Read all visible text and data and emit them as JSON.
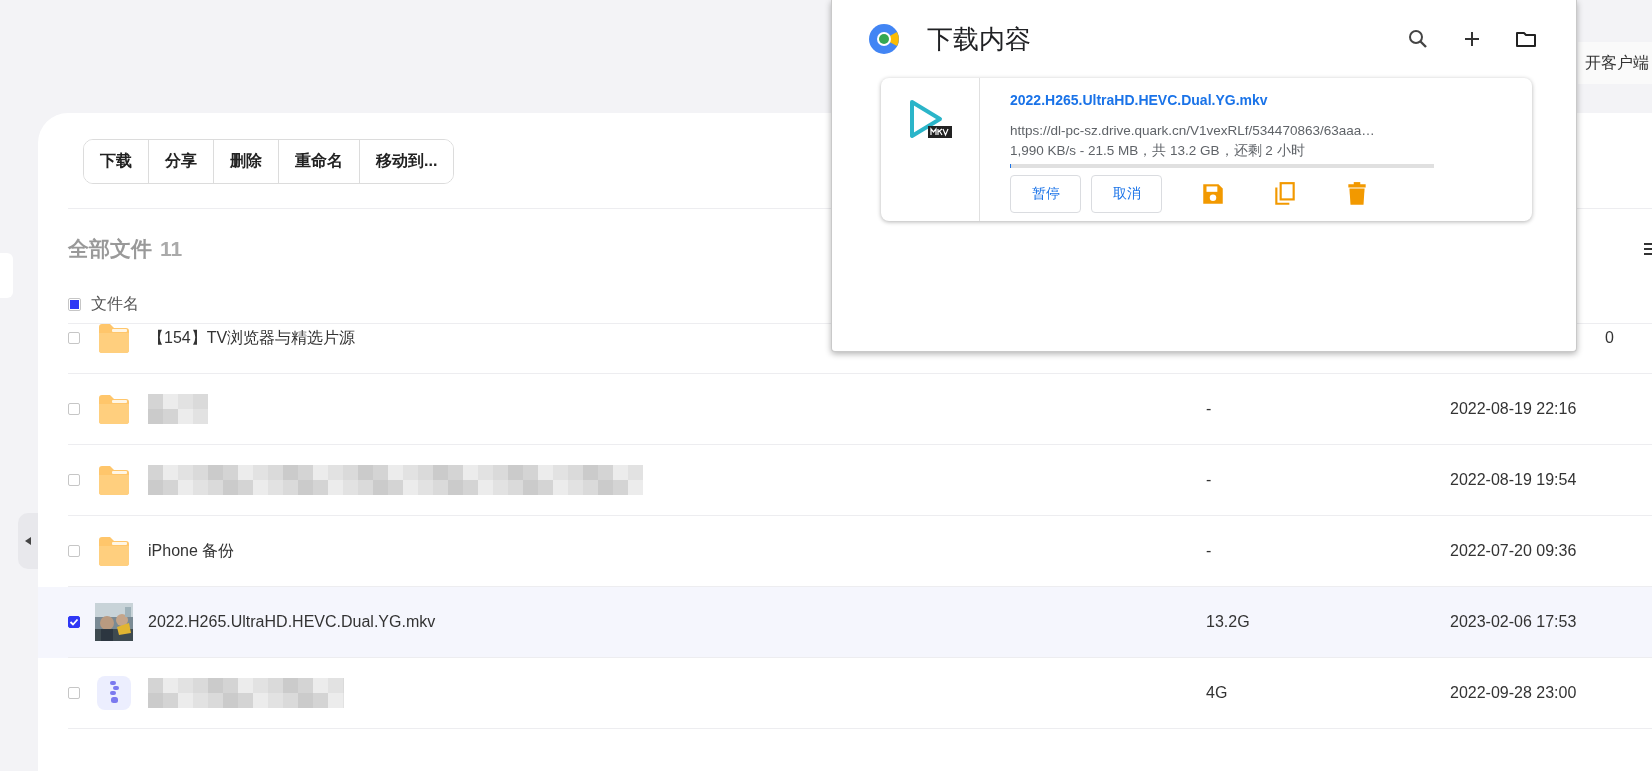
{
  "top_bar": {
    "client_button": "开客户端"
  },
  "toolbar": {
    "buttons": [
      "下载",
      "分享",
      "删除",
      "重命名",
      "移动到..."
    ]
  },
  "folder_title": {
    "label": "全部文件",
    "count": "11"
  },
  "table": {
    "select_all": {
      "indeterminate": true
    },
    "columns": [
      "文件名"
    ],
    "rows": [
      {
        "kind": "folder",
        "name": "【154】TV浏览器与精选片源",
        "checked": false,
        "date": "0",
        "covered_by_popup": true
      },
      {
        "kind": "folder",
        "redacted": true,
        "checked": false,
        "size": "-",
        "date": "2022-08-19 22:16"
      },
      {
        "kind": "folder",
        "redacted": true,
        "checked": false,
        "size": "-",
        "date": "2022-08-19 19:54"
      },
      {
        "kind": "folder",
        "name": "iPhone 备份",
        "checked": false,
        "size": "-",
        "date": "2022-07-20 09:36"
      },
      {
        "kind": "video",
        "name": "2022.H265.UltraHD.HEVC.Dual.YG.mkv",
        "checked": true,
        "size": "13.2G",
        "date": "2023-02-06 17:53"
      },
      {
        "kind": "archive",
        "redacted": true,
        "checked": false,
        "size": "4G",
        "date": "2022-09-28 23:00"
      }
    ]
  },
  "download_popup": {
    "title": "下载内容",
    "item": {
      "file_name": "2022.H265.UltraHD.HEVC.Dual.YG.mkv",
      "url": "https://dl-pc-sz.drive.quark.cn/V1vexRLf/534470863/63aaa…",
      "status": "1,990 KB/s - 21.5 MB，共 13.2 GB，还剩 2 小时",
      "level": 0.002,
      "buttons": [
        "暂停",
        "取消"
      ]
    }
  }
}
